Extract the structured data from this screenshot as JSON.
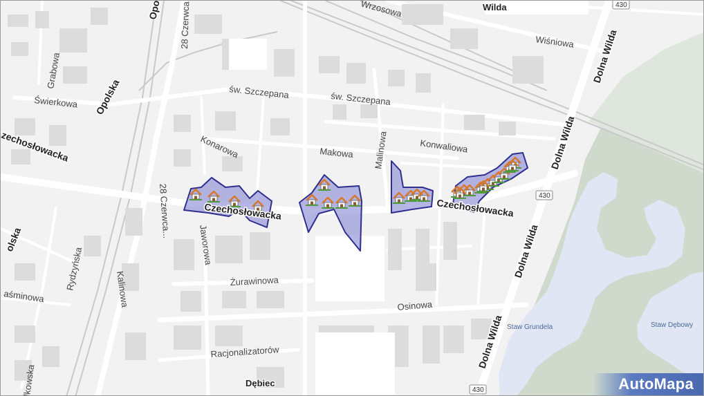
{
  "map": {
    "colors": {
      "background": "#f2f2f2",
      "road": "#ffffff",
      "building": "#dcdcdc",
      "green": "#cfdacd",
      "water": "#e0e6f3",
      "zone_fill": "#8f8fd6",
      "zone_stroke": "#2f2f8f",
      "railway": "#c6c6c6"
    },
    "districts": {
      "wilda": "Wilda",
      "debiec": "Dębiec"
    },
    "streets": {
      "wrzosowa": "Wrzosowa",
      "wisniowa": "Wiśniowa",
      "dolna_wilda_1": "Dolna Wilda",
      "dolna_wilda_2": "Dolna Wilda",
      "dolna_wilda_3": "Dolna Wilda",
      "dolna_wilda_4": "Dolna Wilda",
      "opolska_1": "Opolska",
      "opolska_2": "Opolska",
      "opolska_3": "olska",
      "czerwca_1": "28 Czerwca",
      "czerwca_2": "28 Czerwca...",
      "grabowa": "Grabowa",
      "swierkowa": "Świerkowa",
      "sw_szczepana_1": "św. Szczepana",
      "sw_szczepana_2": "św. Szczepana",
      "czechoslowacka_1": "zechosłowacka",
      "czechoslowacka_2": "Czechosłowacka",
      "czechoslowacka_3": "Czechosłowacka",
      "konarowa": "Konarowa",
      "makowa": "Makowa",
      "malinowa": "Malinowa",
      "konwaliowa": "Konwaliowa",
      "jaworowa": "Jaworowa",
      "zurawinowa": "Żurawinowa",
      "osinowa": "Osinowa",
      "kalinowa": "Kalinowa",
      "rydzynska": "Rydzyńska",
      "jasminowa": "aśminowa",
      "racjonalizatorow": "Racjonalizatorów",
      "lkowska": "lkowska"
    },
    "road_shields": {
      "top": "430",
      "middle": "430",
      "bottom": "430"
    },
    "water": {
      "staw_grundela": "Staw Grundela",
      "staw_debowy": "Staw Dębowy"
    },
    "markers": {
      "icon": "house-icon",
      "zone_count": 5,
      "marker_count": 26
    },
    "logo": "AutoMapa"
  }
}
